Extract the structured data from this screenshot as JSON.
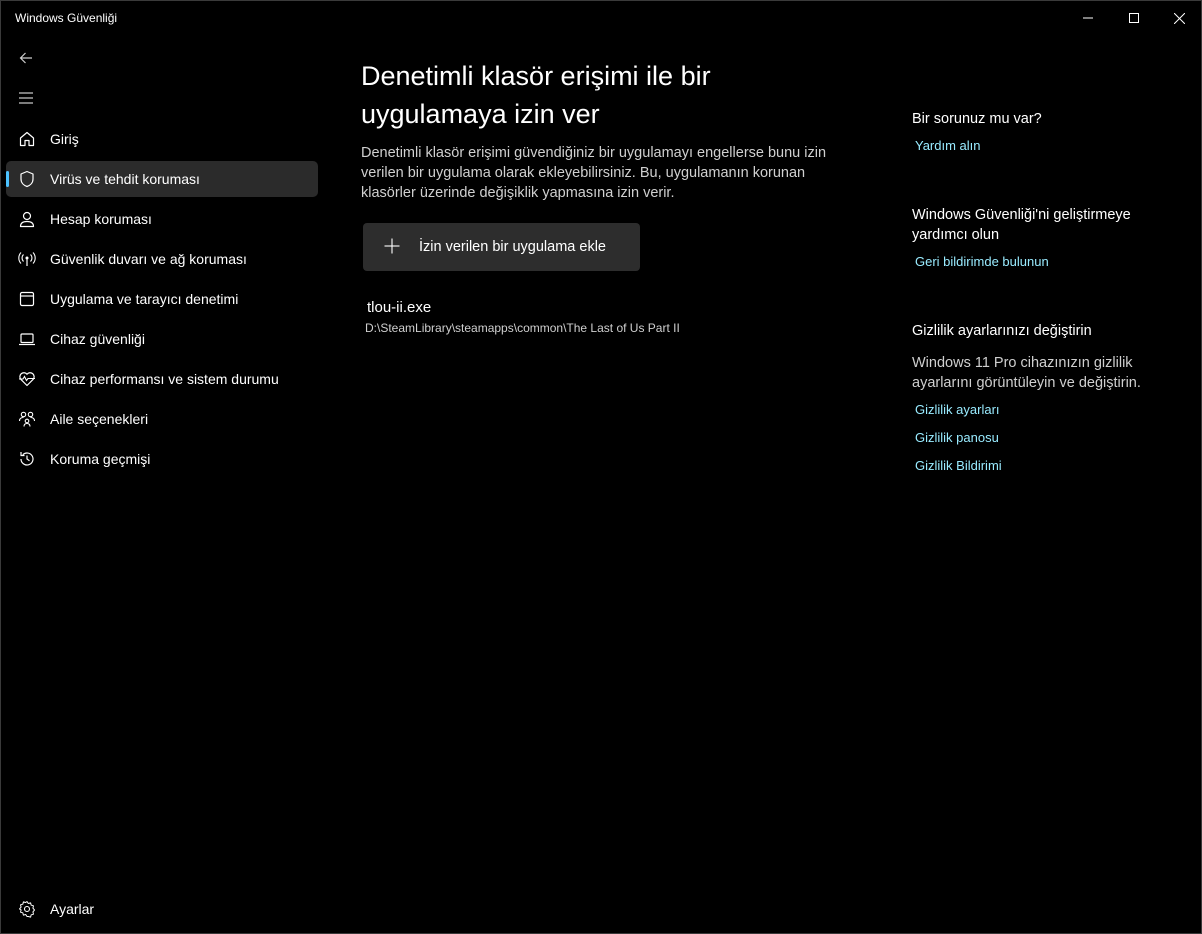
{
  "window": {
    "title": "Windows Güvenliği"
  },
  "nav": {
    "items": [
      {
        "label": "Giriş",
        "icon": "home-icon",
        "active": false
      },
      {
        "label": "Virüs ve tehdit koruması",
        "icon": "shield-icon",
        "active": true
      },
      {
        "label": "Hesap koruması",
        "icon": "person-icon",
        "active": false
      },
      {
        "label": "Güvenlik duvarı ve ağ koruması",
        "icon": "antenna-icon",
        "active": false
      },
      {
        "label": "Uygulama ve tarayıcı denetimi",
        "icon": "app-window-icon",
        "active": false
      },
      {
        "label": "Cihaz güvenliği",
        "icon": "laptop-icon",
        "active": false
      },
      {
        "label": "Cihaz performansı ve sistem durumu",
        "icon": "heart-pulse-icon",
        "active": false
      },
      {
        "label": "Aile seçenekleri",
        "icon": "family-icon",
        "active": false
      },
      {
        "label": "Koruma geçmişi",
        "icon": "history-icon",
        "active": false
      }
    ],
    "settings_label": "Ayarlar"
  },
  "main": {
    "title_line1": "Denetimli klasör erişimi ile bir",
    "title_line2": "uygulamaya izin ver",
    "desc_line1": "Denetimli klasör erişimi güvendiğiniz bir uygulamayı engellerse bunu izin",
    "desc_line2": "verilen bir uygulama olarak ekleyebilirsiniz. Bu, uygulamanın korunan",
    "desc_line3": "klasörler üzerinde değişiklik yapmasına izin verir.",
    "add_button_label": "İzin verilen bir uygulama ekle",
    "apps": [
      {
        "name": "tlou-ii.exe",
        "path": "D:\\SteamLibrary\\steamapps\\common\\The Last of Us Part II"
      }
    ]
  },
  "side": {
    "help_heading": "Bir sorunuz mu var?",
    "help_link": "Yardım alın",
    "improve_heading_line1": "Windows Güvenliği'ni geliştirmeye",
    "improve_heading_line2": "yardımcı olun",
    "feedback_link": "Geri bildirimde bulunun",
    "privacy_heading": "Gizlilik ayarlarınızı değiştirin",
    "privacy_text_line1": "Windows 11 Pro cihazınızın gizlilik",
    "privacy_text_line2": "ayarlarını görüntüleyin ve değiştirin.",
    "privacy_links": [
      "Gizlilik ayarları",
      "Gizlilik panosu",
      "Gizlilik Bildirimi"
    ]
  },
  "colors": {
    "accent": "#4cc2ff",
    "link": "#99ebff",
    "active_bg": "#2b2b2b",
    "button_bg": "#2d2d2d"
  }
}
